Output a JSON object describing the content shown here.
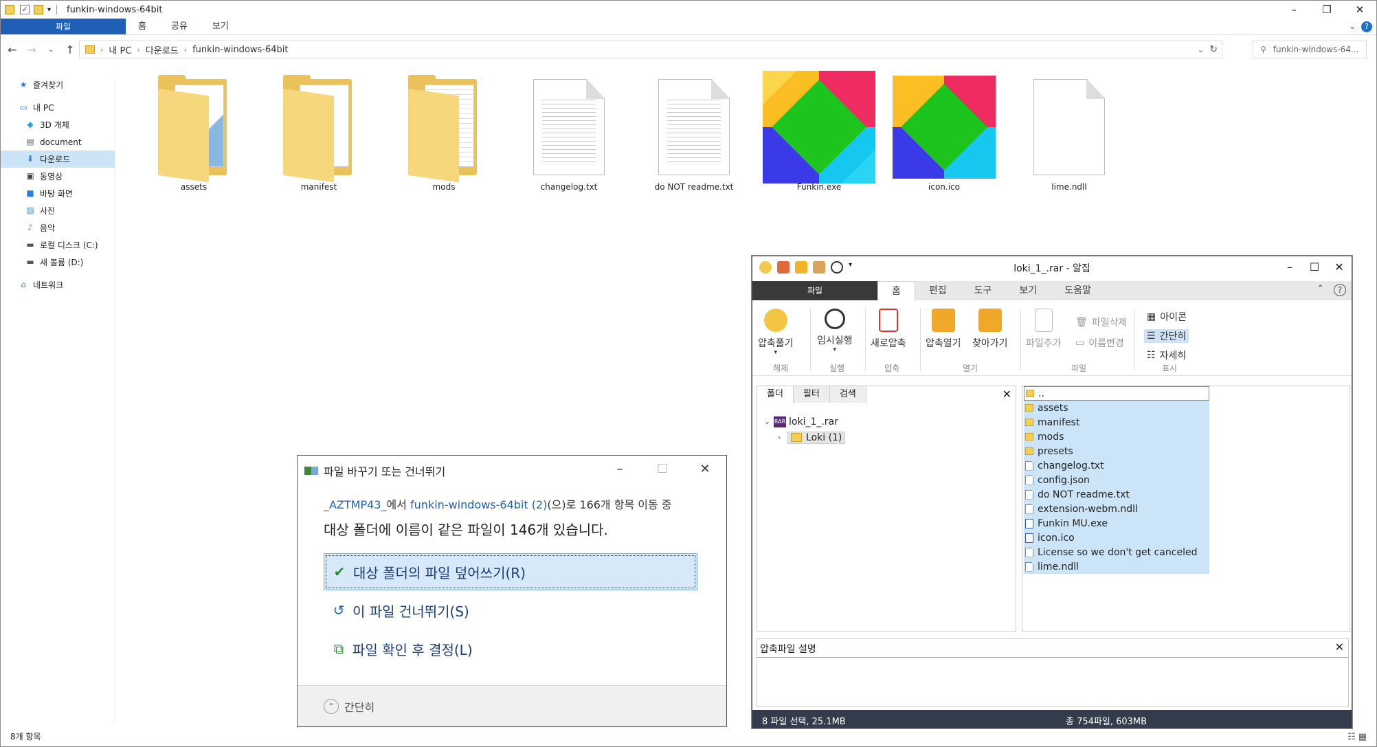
{
  "explorer": {
    "title": "funkin-windows-64bit",
    "ribbon_tabs": [
      "파일",
      "홈",
      "공유",
      "보기"
    ],
    "breadcrumb": [
      "내 PC",
      "다운로드",
      "funkin-windows-64bit"
    ],
    "search_placeholder": "funkin-windows-64...",
    "nav": [
      {
        "label": "즐겨찾기",
        "icon": "star-icon",
        "sub": false
      },
      {
        "label": "내 PC",
        "icon": "computer-icon",
        "sub": false
      },
      {
        "label": "3D 개체",
        "icon": "cube-icon",
        "sub": true
      },
      {
        "label": "document",
        "icon": "document-icon",
        "sub": true
      },
      {
        "label": "다운로드",
        "icon": "download-icon",
        "sub": true,
        "selected": true
      },
      {
        "label": "동영상",
        "icon": "video-icon",
        "sub": true
      },
      {
        "label": "바탕 화면",
        "icon": "desktop-icon",
        "sub": true
      },
      {
        "label": "사진",
        "icon": "pictures-icon",
        "sub": true
      },
      {
        "label": "음악",
        "icon": "music-icon",
        "sub": true
      },
      {
        "label": "로컬 디스크 (C:)",
        "icon": "drive-icon",
        "sub": true
      },
      {
        "label": "새 볼륨 (D:)",
        "icon": "drive-icon",
        "sub": true
      },
      {
        "label": "네트워크",
        "icon": "network-icon",
        "sub": false
      }
    ],
    "files": [
      {
        "name": "assets",
        "type": "folder"
      },
      {
        "name": "manifest",
        "type": "folder"
      },
      {
        "name": "mods",
        "type": "folder"
      },
      {
        "name": "changelog.txt",
        "type": "text"
      },
      {
        "name": "do NOT readme.txt",
        "type": "text"
      },
      {
        "name": "Funkin.exe",
        "type": "logo"
      },
      {
        "name": "icon.ico",
        "type": "logo"
      },
      {
        "name": "lime.ndll",
        "type": "blank"
      }
    ],
    "status": "8개 항목"
  },
  "alzip": {
    "title": "loki_1_.rar - 알집",
    "tabs": [
      "파일",
      "홈",
      "편집",
      "도구",
      "보기",
      "도움말"
    ],
    "ribbon": {
      "extract": "압축풀기",
      "temp_run": "임시실행",
      "new_zip": "새로압축",
      "open_zip": "압축열기",
      "goto": "찾아가기",
      "add_file": "파일추가",
      "delete_file": "파일삭제",
      "rename": "이름변경",
      "view_icon": "아이콘",
      "view_simple": "간단히",
      "view_detail": "자세히",
      "groups": [
        "해제",
        "실행",
        "압축",
        "열기",
        "파일",
        "표시"
      ]
    },
    "left_tabs": [
      "폴더",
      "필터",
      "검색"
    ],
    "tree_root": "loki_1_.rar",
    "tree_child": "Loki (1)",
    "file_list": [
      {
        "name": "..",
        "kind": "fold"
      },
      {
        "name": "assets",
        "kind": "fold"
      },
      {
        "name": "manifest",
        "kind": "fold"
      },
      {
        "name": "mods",
        "kind": "fold"
      },
      {
        "name": "presets",
        "kind": "fold"
      },
      {
        "name": "changelog.txt",
        "kind": "doc"
      },
      {
        "name": "config.json",
        "kind": "doc"
      },
      {
        "name": "do NOT readme.txt",
        "kind": "doc"
      },
      {
        "name": "extension-webm.ndll",
        "kind": "doc"
      },
      {
        "name": "Funkin MU.exe",
        "kind": "exe"
      },
      {
        "name": "icon.ico",
        "kind": "exe"
      },
      {
        "name": "License so we don't get canceled",
        "kind": "doc"
      },
      {
        "name": "lime.ndll",
        "kind": "doc"
      }
    ],
    "desc_label": "압축파일 설명",
    "status_left": "8 파일 선택,  25.1MB",
    "status_right": "총 754파일,  603MB"
  },
  "dialog": {
    "title": "파일 바꾸기 또는 건너뛰기",
    "src": "_AZTMP43_",
    "src_suffix": "에서 ",
    "dst": "funkin-windows-64bit (2)",
    "dst_suffix": "(으)로 166개 항목 이동 중",
    "message": "대상 폴더에 이름이 같은 파일이 146개 있습니다.",
    "opt_replace": "대상 폴더의 파일 덮어쓰기(R)",
    "opt_skip": "이 파일 건너뛰기(S)",
    "opt_decide": "파일 확인 후 결정(L)",
    "more": "간단히"
  }
}
